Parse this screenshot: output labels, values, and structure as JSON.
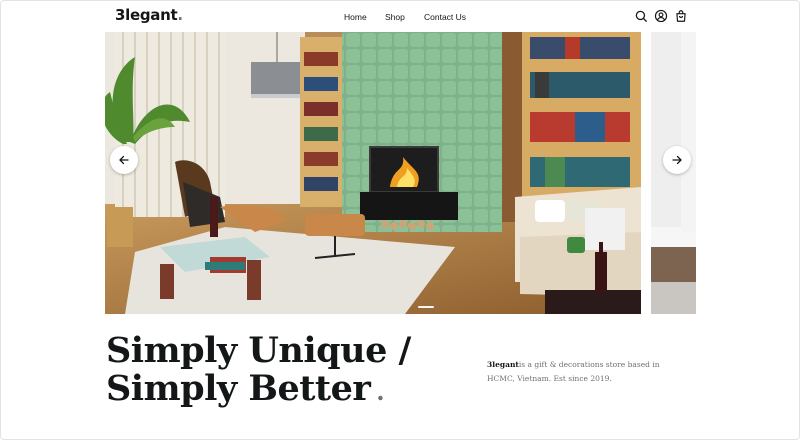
{
  "header": {
    "logo_text": "3legant",
    "logo_dot": ".",
    "nav": [
      {
        "label": "Home"
      },
      {
        "label": "Shop"
      },
      {
        "label": "Contact Us"
      }
    ],
    "icons": [
      "search-icon",
      "user-icon",
      "shopping-bag-icon"
    ]
  },
  "slider": {
    "image_subject": "living room interior with green tiled fireplace wall, bookshelves, lounge chair and sofa",
    "prev_icon": "arrow-left-icon",
    "next_icon": "arrow-right-icon",
    "active_slide": 1
  },
  "hero": {
    "headline_line1": "Simply Unique /",
    "headline_line2": "Simply Better",
    "headline_period": ".",
    "tagline_brand": "3legant",
    "tagline_text": "is a gift & decorations store based in HCMC, Vietnam. Est since 2019."
  },
  "colors": {
    "text_primary": "#141718",
    "text_secondary": "#6c7275",
    "background": "#ffffff"
  }
}
